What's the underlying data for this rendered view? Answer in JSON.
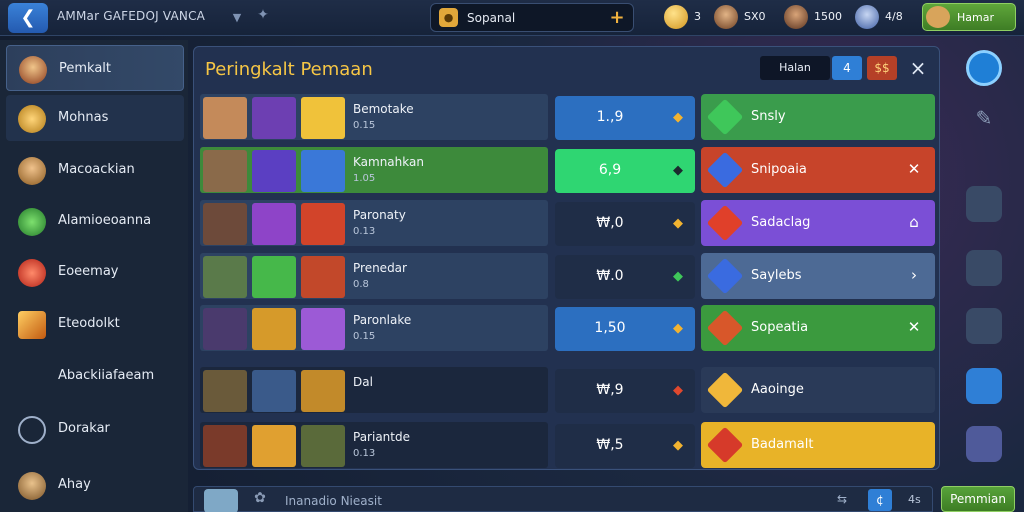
{
  "topbar": {
    "back_icon": "back-arrow-icon",
    "title": "AMMar GAFEDOJ VANCA",
    "search_label": "Sopanal",
    "stats": [
      {
        "icon": "gold-coin-icon",
        "value": "3"
      },
      {
        "icon": "hero-portrait-icon",
        "value": "SX0"
      },
      {
        "icon": "hero-portrait-icon",
        "value": "1500"
      },
      {
        "icon": "hero-portrait-icon",
        "value": "4/8"
      }
    ],
    "profile_label": "Hamar"
  },
  "sidebar": {
    "items": [
      {
        "label": "Pemkalt",
        "icon": "player-avatar-icon"
      },
      {
        "label": "Mohnas",
        "icon": "gold-emblem-icon"
      },
      {
        "label": "Macoackian",
        "icon": "helmet-avatar-icon"
      },
      {
        "label": "Alamioeoanna",
        "icon": "green-gem-icon"
      },
      {
        "label": "Eoeemay",
        "icon": "red-orb-icon"
      },
      {
        "label": "Eteodolkt",
        "icon": "sword-icon"
      },
      {
        "label": "Abackiiafaeam",
        "icon": ""
      },
      {
        "label": "Dorakar",
        "icon": "compass-icon"
      },
      {
        "label": "Ahay",
        "icon": "bearded-avatar-icon"
      }
    ]
  },
  "panel": {
    "title": "Peringkalt Pemaan",
    "tab_all": "Halan",
    "tab_blue": "4",
    "tab_red": "$$",
    "close_icon": "×",
    "rows": [
      {
        "name": "Bemotake",
        "sub": "0.15",
        "score": "1.,9",
        "score_icon": "amber-gem-icon",
        "result": "Snsly",
        "result_icon": "green-gem-icon",
        "action": "",
        "score_bg": "#2c6fc0",
        "result_bg": "#3a9c4c",
        "row_bg": "#2d4262"
      },
      {
        "name": "Kamnahkan",
        "sub": "1.05",
        "score": "6,9",
        "score_icon": "dark-chevron-icon",
        "result": "Snipoaia",
        "result_icon": "blue-cube-icon",
        "action": "✕",
        "score_bg": "#2fd672",
        "result_bg": "#c7442a",
        "row_bg": "#3d8a3b"
      },
      {
        "name": "Paronaty",
        "sub": "0.13",
        "score": "₩,0",
        "score_icon": "amber-gem-icon",
        "result": "Sadaclag",
        "result_icon": "red-cube-icon",
        "action": "⌂",
        "score_bg": "#1f2d47",
        "result_bg": "#7b4fd6",
        "row_bg": "#2d4262"
      },
      {
        "name": "Prenedar",
        "sub": "0.8",
        "score": "₩.0",
        "score_icon": "green-gem-icon",
        "result": "Saylebs",
        "result_icon": "blue-cube-icon",
        "action": "›",
        "score_bg": "#1f2d47",
        "result_bg": "#4d6a95",
        "row_bg": "#2d4262"
      },
      {
        "name": "Paronlake",
        "sub": "0.15",
        "score": "1,50",
        "score_icon": "amber-gem-icon",
        "result": "Sopeatia",
        "result_icon": "crossed-swords-icon",
        "action": "✕",
        "score_bg": "#2c6fc0",
        "result_bg": "#3b9a3e",
        "row_bg": "#2d4262"
      },
      {
        "name": "Dal",
        "sub": "",
        "score": "₩,9",
        "score_icon": "red-gem-icon",
        "result": "Aaoinge",
        "result_icon": "gold-cube-icon",
        "action": "",
        "score_bg": "#1f2d47",
        "result_bg": "#2a3a58",
        "row_bg": "#1b273d"
      },
      {
        "name": "Pariantde",
        "sub": "0.13",
        "score": "₩,5",
        "score_icon": "amber-gem-icon",
        "result": "Badamalt",
        "result_icon": "red-star-icon",
        "action": "",
        "score_bg": "#1f2d47",
        "result_bg": "#e8b328",
        "row_bg": "#1b273d"
      }
    ]
  },
  "bottombar": {
    "text": "Inanadio Nieasit",
    "tag1": "⇆",
    "tag2": "¢",
    "tag3": "4s",
    "send_label": "Pemmian"
  }
}
